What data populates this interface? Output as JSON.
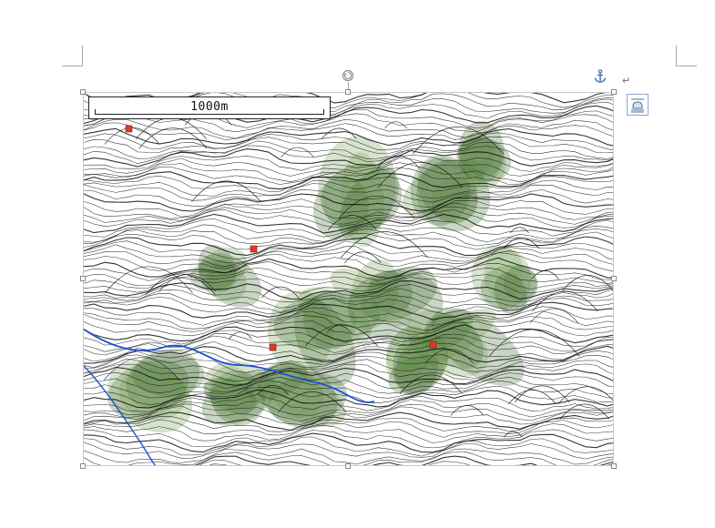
{
  "document": {
    "scale_bar_label": "1000m",
    "paragraph_mark": "↵"
  },
  "icons": {
    "anchor": "anchor-icon",
    "rotate": "rotate-handle-icon",
    "layout_options": "layout-options-icon"
  },
  "colors": {
    "contour": "#111111",
    "forest_shade": "#6f9a4f",
    "forest_dark": "#3f6a2e",
    "river": "#1d4fd8",
    "marker": "#e03a2a",
    "selection_handle": "#8c8c8c",
    "anchor": "#4a78b8"
  }
}
